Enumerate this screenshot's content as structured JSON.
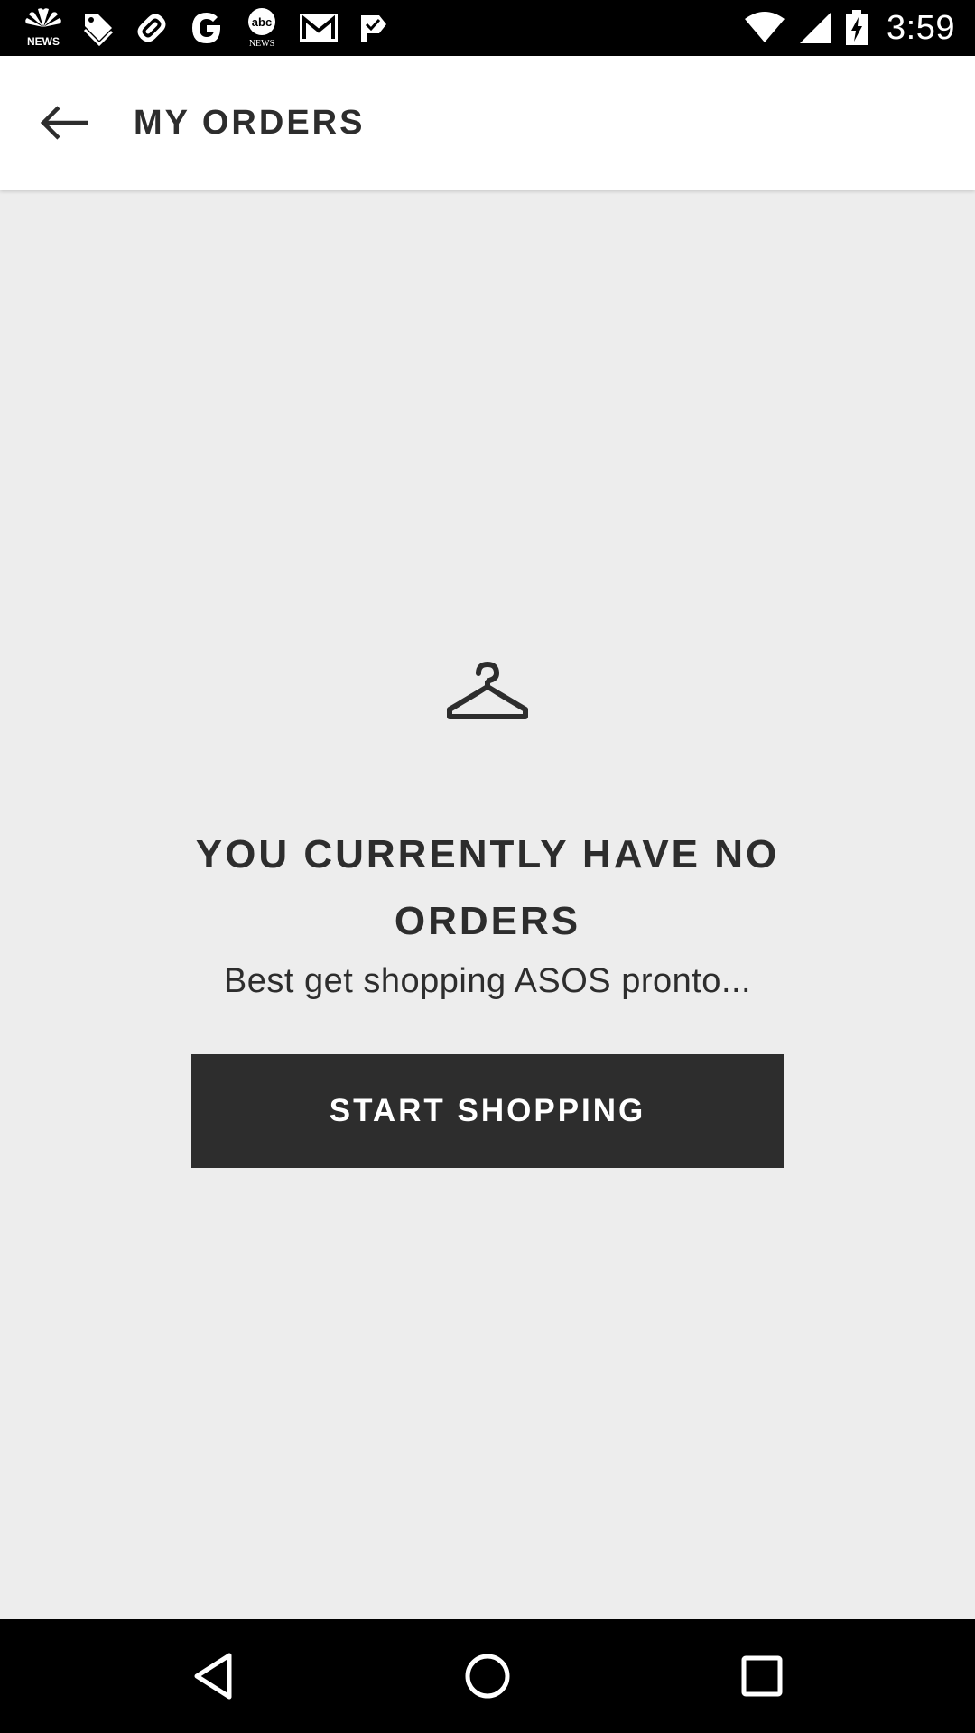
{
  "status_bar": {
    "time": "3:59",
    "notification_icons": [
      "nbc-news-icon",
      "tag-icon",
      "link-icon",
      "google-icon",
      "abc-news-icon",
      "gmail-icon",
      "check-flag-icon"
    ],
    "system_icons": [
      "wifi-icon",
      "cell-signal-icon",
      "battery-charging-icon"
    ],
    "nbc_label": "NEWS",
    "abc_label": "abc",
    "abc_sub": "NEWS"
  },
  "app_bar": {
    "title": "MY ORDERS",
    "back_icon": "arrow-back-icon"
  },
  "empty_state": {
    "icon": "hanger-icon",
    "title": "YOU CURRENTLY HAVE NO ORDERS",
    "subtitle": "Best get shopping ASOS pronto...",
    "button_label": "START SHOPPING"
  },
  "nav_bar": {
    "icons": [
      "nav-back-icon",
      "nav-home-icon",
      "nav-recents-icon"
    ]
  },
  "colors": {
    "background": "#ededed",
    "app_bar": "#ffffff",
    "text_dark": "#2d2d2d",
    "button_bg": "#2d2d2d",
    "button_text": "#ffffff",
    "system_bars": "#000000"
  }
}
